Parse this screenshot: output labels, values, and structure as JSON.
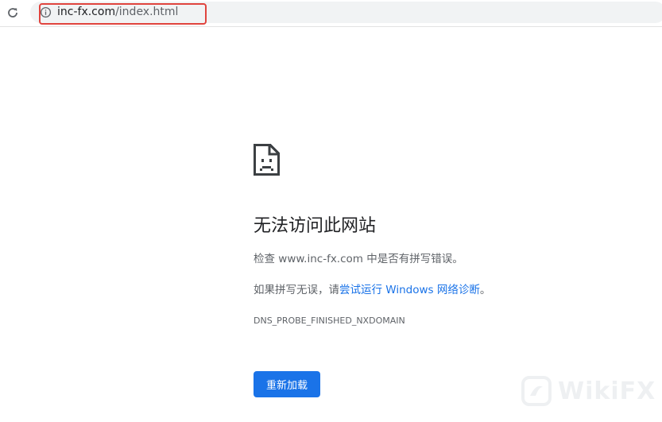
{
  "browser": {
    "url_domain": "inc-fx.com",
    "url_path": "/index.html"
  },
  "error": {
    "title": "无法访问此网站",
    "message_line1": "检查 www.inc-fx.com 中是否有拼写错误。",
    "message_line2_prefix": "如果拼写无误，请",
    "message_line2_link": "尝试运行 Windows 网络诊断",
    "message_line2_suffix": "。",
    "code": "DNS_PROBE_FINISHED_NXDOMAIN",
    "reload_label": "重新加载"
  },
  "watermark": {
    "text": "WikiFX"
  },
  "colors": {
    "link": "#1a73e8",
    "button": "#1a73e8",
    "highlight": "#e0443e"
  },
  "icons": [
    "reload-icon",
    "info-icon",
    "sad-page-icon",
    "wikifx-logo-icon"
  ]
}
